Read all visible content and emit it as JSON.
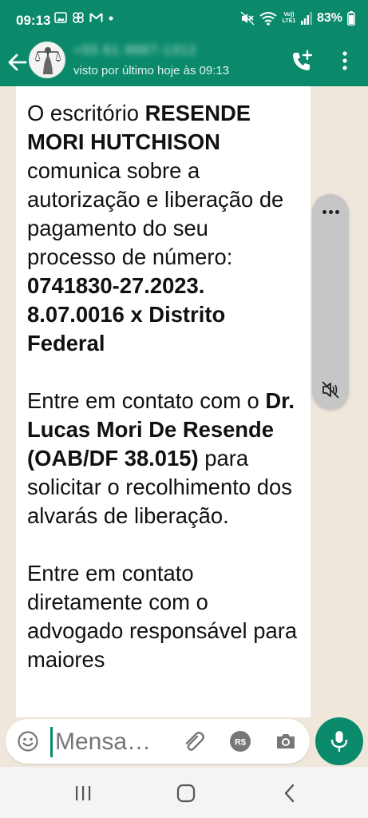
{
  "status_bar": {
    "time": "09:13",
    "battery": "83%",
    "network": "Vo)) LTE1"
  },
  "header": {
    "contact_name": "+55 61 9887-1312",
    "last_seen": "visto por último hoje às 09:13"
  },
  "message": {
    "parts": [
      {
        "text": "O escritório ",
        "bold": false
      },
      {
        "text": "RESENDE MORI HUTCHISON",
        "bold": true
      },
      {
        "text": " comunica sobre a autorização e liberação de pagamento do seu processo de número: ",
        "bold": false
      },
      {
        "text": "0741830-27.2023. 8.07.0016 x Distrito Federal",
        "bold": true
      },
      {
        "text": "\n\nEntre em contato com o ",
        "bold": false
      },
      {
        "text": "Dr. Lucas Mori De Resende (OAB/DF 38.015)",
        "bold": true
      },
      {
        "text": " para solicitar o recolhimento dos alvarás de liberação.\n\nEntre em contato diretamente com o advogado responsável para maiores",
        "bold": false
      }
    ]
  },
  "input": {
    "placeholder": "Mensa…"
  },
  "colors": {
    "primary": "#0b8a6b",
    "chat_background": "#efe7dc",
    "bubble": "#ffffff"
  },
  "icons": {
    "back": "arrow-left-icon",
    "call": "add-call-icon",
    "menu": "more-vertical-icon",
    "emoji": "emoji-icon",
    "attach": "paperclip-icon",
    "pay": "payment-icon",
    "camera": "camera-icon",
    "mic": "microphone-icon"
  }
}
